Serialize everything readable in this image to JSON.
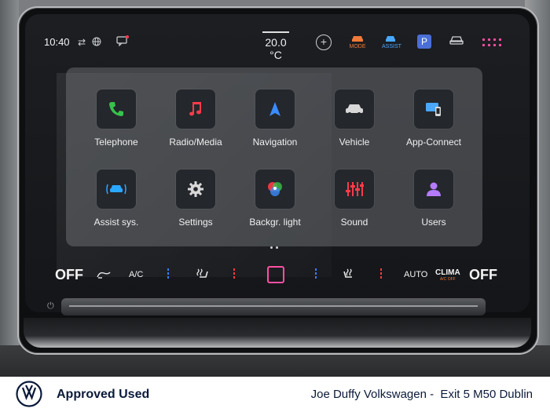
{
  "status_bar": {
    "time": "10:40",
    "temperature": "20.0 °C",
    "mode_label": "MODE",
    "assist_label": "ASSIST",
    "park_label": "P"
  },
  "apps": [
    {
      "label": "Telephone",
      "icon": "phone-icon",
      "color": "#37c24a"
    },
    {
      "label": "Radio/Media",
      "icon": "music-note-icon",
      "color": "#ff3b4a"
    },
    {
      "label": "Navigation",
      "icon": "navigation-arrow-icon",
      "color": "#3a8cff"
    },
    {
      "label": "Vehicle",
      "icon": "car-icon",
      "color": "#d8d8d8"
    },
    {
      "label": "App-Connect",
      "icon": "app-connect-icon",
      "color": "#4aa8ff"
    },
    {
      "label": "Assist sys.",
      "icon": "assist-car-icon",
      "color": "#2aa8ff"
    },
    {
      "label": "Settings",
      "icon": "gear-icon",
      "color": "#d8d8d8"
    },
    {
      "label": "Backgr. light",
      "icon": "rgb-circles-icon",
      "color": "#ffffff"
    },
    {
      "label": "Sound",
      "icon": "sliders-icon",
      "color": "#ff3b4a"
    },
    {
      "label": "Users",
      "icon": "user-icon",
      "color": "#b57bff"
    }
  ],
  "climate": {
    "left_off": "OFF",
    "ac": "A/C",
    "auto": "AUTO",
    "clima": "CLIMA",
    "clima_sub": "A/C OFF",
    "right_off": "OFF"
  },
  "footer": {
    "brand": "Approved Used",
    "dealer": "Joe Duffy Volkswagen -  Exit 5 M50 Dublin"
  }
}
